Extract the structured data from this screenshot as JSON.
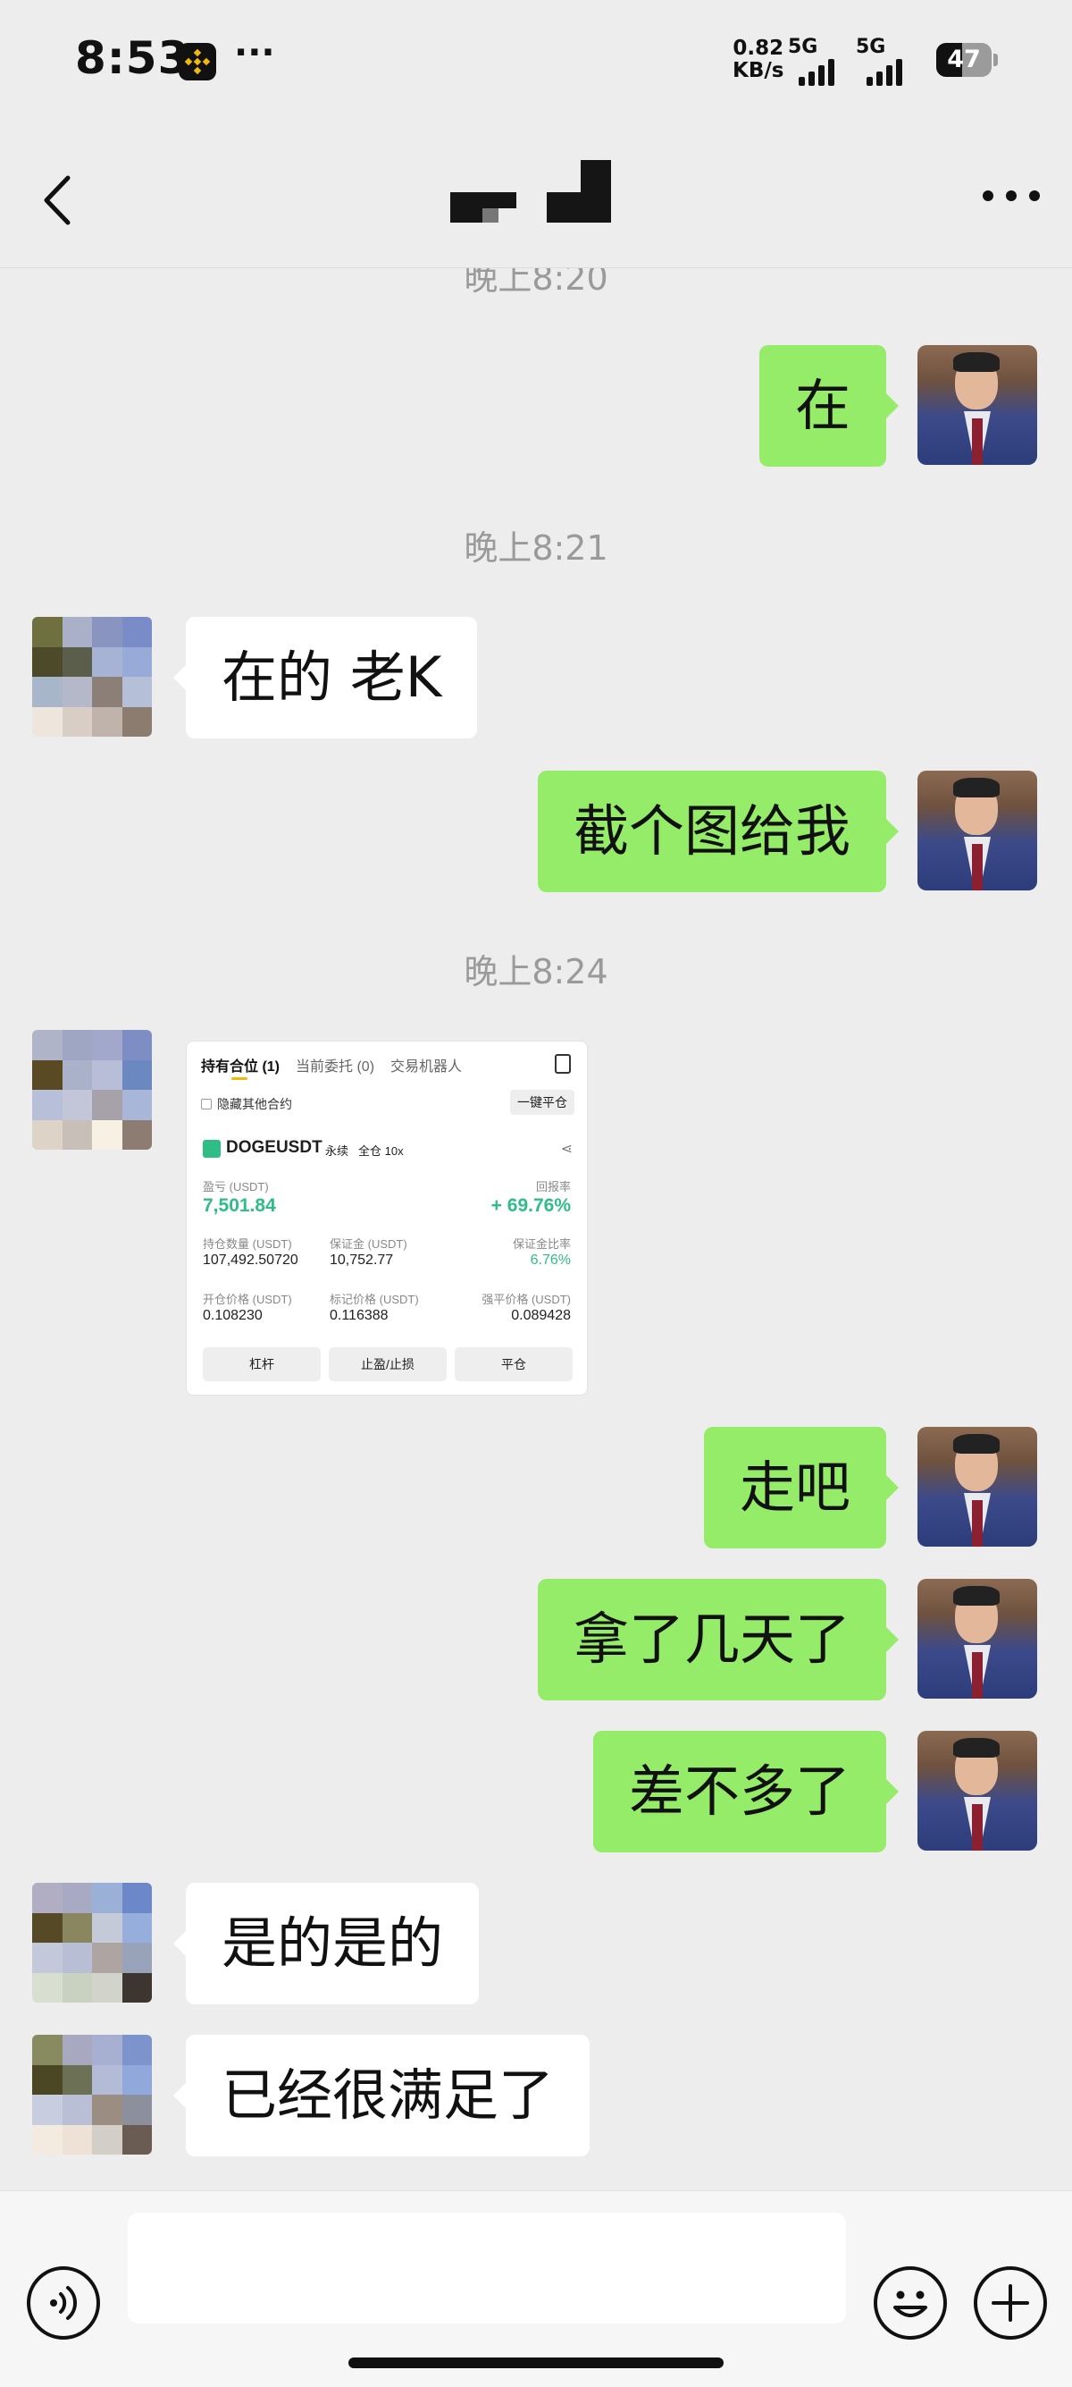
{
  "status_bar": {
    "time": "8:53",
    "extra": "···",
    "net_speed_value": "0.82",
    "net_speed_unit": "KB/s",
    "signal1_label": "5G",
    "signal2_label": "5G",
    "battery": "47",
    "battery_level": 0.47
  },
  "nav": {
    "back_icon": "chevron-left-icon",
    "more_icon": "more-dots-icon"
  },
  "colors": {
    "background": "#ededed",
    "my_bubble": "#95ec69",
    "other_bubble": "#ffffff",
    "positive": "#2ebd85"
  },
  "timestamps": [
    "晚上8:20",
    "晚上8:21",
    "晚上8:24"
  ],
  "messages": [
    {
      "side": "me",
      "text": "在"
    },
    {
      "side": "other",
      "text": "在的 老K"
    },
    {
      "side": "me",
      "text": "截个图给我"
    },
    {
      "side": "me",
      "text": "走吧"
    },
    {
      "side": "me",
      "text": "拿了几天了"
    },
    {
      "side": "me",
      "text": "差不多了"
    },
    {
      "side": "other",
      "text": "是的是的"
    },
    {
      "side": "other",
      "text": "已经很满足了"
    }
  ],
  "screenshot": {
    "tabs": [
      "持有合位 (1)",
      "当前委托 (0)",
      "交易机器人"
    ],
    "hide_others": "隐藏其他合约",
    "close_all": "一键平仓",
    "symbol": "DOGEUSDT",
    "contract_type": "永续",
    "margin_mode": "全仓 10x",
    "pnl_label": "盈亏 (USDT)",
    "pnl_value": "7,501.84",
    "roi_label": "回报率",
    "roi_value": "+ 69.76%",
    "size_label": "持仓数量 (USDT)",
    "size_value": "107,492.50720",
    "margin_label": "保证金 (USDT)",
    "margin_value": "10,752.77",
    "margin_ratio_label": "保证金比率",
    "margin_ratio_value": "6.76%",
    "entry_label": "开仓价格 (USDT)",
    "entry_value": "0.108230",
    "mark_label": "标记价格 (USDT)",
    "mark_value": "0.116388",
    "liq_label": "强平价格 (USDT)",
    "liq_value": "0.089428",
    "buttons": [
      "杠杆",
      "止盈/止损",
      "平仓"
    ]
  },
  "input_bar": {
    "voice_icon": "voice-icon",
    "emoji_icon": "emoji-icon",
    "plus_icon": "plus-icon"
  }
}
